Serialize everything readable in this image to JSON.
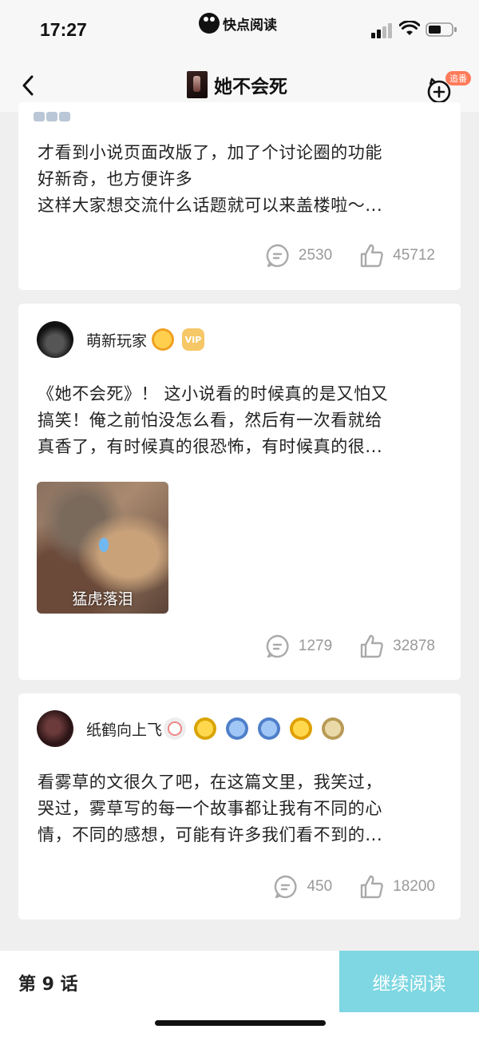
{
  "status_bar": {
    "time": "17:27",
    "app_name": "快点阅读"
  },
  "nav": {
    "title": "她不会死",
    "follow_tag": "追番"
  },
  "posts": [
    {
      "lines": [
        "才看到小说页面改版了，加了个讨论圈的功能",
        "好新奇，也方便许多",
        "这样大家想交流什么话题就可以来盖楼啦～..."
      ],
      "comments": "2530",
      "likes": "45712"
    },
    {
      "username": "萌新玩家",
      "lines": [
        "《她不会死》！ 这小说看的时候真的是又怕又",
        "搞笑！俺之前怕没怎么看，然后有一次看就给",
        "真香了，有时候真的很恐怖，有时候真的很..."
      ],
      "image_caption": "猛虎落泪",
      "comments": "1279",
      "likes": "32878"
    },
    {
      "username": "纸鹤向上飞",
      "lines": [
        "看雾草的文很久了吧，在这篇文里，我笑过，",
        "哭过，雾草写的每一个故事都让我有不同的心",
        "情，不同的感想，可能有许多我们看不到的..."
      ],
      "comments": "450",
      "likes": "18200"
    }
  ],
  "badges": {
    "vip": "VIP"
  },
  "bottom": {
    "chapter": "第 9 话",
    "continue_label": "继续阅读"
  },
  "colors": {
    "accent": "#7ed7e2",
    "follow_tag": "#ff7a59",
    "stat_gray": "#999999"
  }
}
